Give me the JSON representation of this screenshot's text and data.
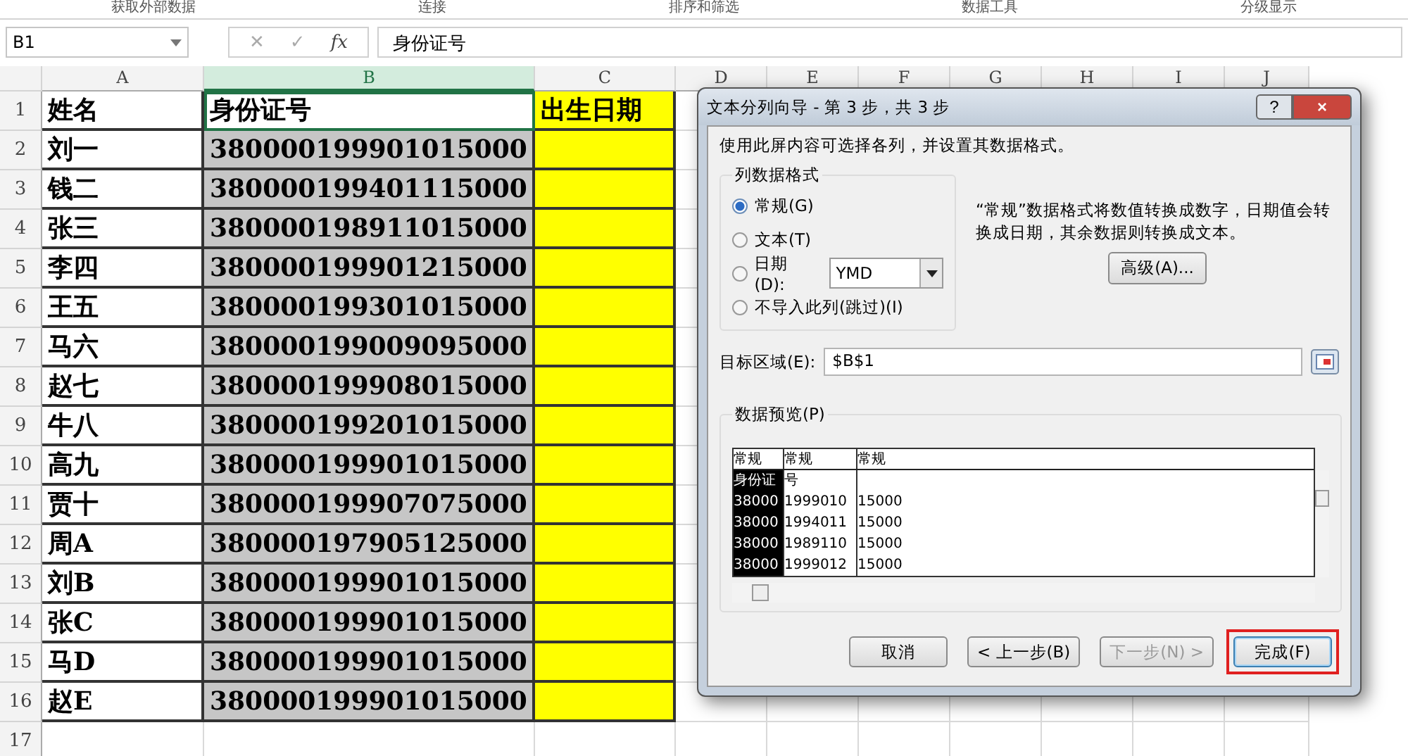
{
  "ribbon_groups": [
    "获取外部数据",
    "连接",
    "排序和筛选",
    "数据工具",
    "分级显示"
  ],
  "name_box": "B1",
  "formula_buttons": [
    {
      "label": "✕",
      "kind": "cancel"
    },
    {
      "label": "✓",
      "kind": "enter"
    },
    {
      "label": "fx",
      "kind": "function"
    }
  ],
  "formula": "身份证号",
  "columns": [
    {
      "label": "A",
      "selected": false,
      "highlighted": false
    },
    {
      "label": "B",
      "selected": true,
      "highlighted": false
    },
    {
      "label": "C",
      "selected": false,
      "highlighted": true
    },
    {
      "label": "D",
      "selected": false,
      "highlighted": false
    },
    {
      "label": "E",
      "selected": false,
      "highlighted": false
    },
    {
      "label": "F",
      "selected": false,
      "highlighted": false
    },
    {
      "label": "G",
      "selected": false,
      "highlighted": false
    },
    {
      "label": "H",
      "selected": false,
      "highlighted": false
    },
    {
      "label": "I",
      "selected": false,
      "highlighted": false
    },
    {
      "label": "J",
      "selected": false,
      "highlighted": false
    }
  ],
  "rows": [
    {
      "number": "1",
      "cells": [
        "姓名",
        "身份证号",
        "出生日期"
      ]
    },
    {
      "number": "2",
      "cells": [
        "刘一",
        "380000199901015000",
        ""
      ]
    },
    {
      "number": "3",
      "cells": [
        "钱二",
        "380000199401115000",
        ""
      ]
    },
    {
      "number": "4",
      "cells": [
        "张三",
        "380000198911015000",
        ""
      ]
    },
    {
      "number": "5",
      "cells": [
        "李四",
        "380000199901215000",
        ""
      ]
    },
    {
      "number": "6",
      "cells": [
        "王五",
        "380000199301015000",
        ""
      ]
    },
    {
      "number": "7",
      "cells": [
        "马六",
        "380000199009095000",
        ""
      ]
    },
    {
      "number": "8",
      "cells": [
        "赵七",
        "380000199908015000",
        ""
      ]
    },
    {
      "number": "9",
      "cells": [
        "牛八",
        "380000199201015000",
        ""
      ]
    },
    {
      "number": "10",
      "cells": [
        "高九",
        "380000199901015000",
        ""
      ]
    },
    {
      "number": "11",
      "cells": [
        "贾十",
        "380000199907075000",
        ""
      ]
    },
    {
      "number": "12",
      "cells": [
        "周A",
        "380000197905125000",
        ""
      ]
    },
    {
      "number": "13",
      "cells": [
        "刘B",
        "380000199901015000",
        ""
      ]
    },
    {
      "number": "14",
      "cells": [
        "张C",
        "380000199901015000",
        ""
      ]
    },
    {
      "number": "15",
      "cells": [
        "马D",
        "380000199901015000",
        ""
      ]
    },
    {
      "number": "16",
      "cells": [
        "赵E",
        "380000199901015000",
        ""
      ]
    },
    {
      "number": "17",
      "cells": []
    }
  ],
  "dialog": {
    "title": "文本分列向导 - 第 3 步，共 3 步",
    "help": "?",
    "close": "×",
    "intro": "使用此屏内容可选择各列，并设置其数据格式。",
    "format_group": {
      "title": "列数据格式",
      "options": [
        {
          "label": "常规(G)",
          "selected": true
        },
        {
          "label": "文本(T)",
          "selected": false
        },
        {
          "label": "日期(D):",
          "selected": false,
          "dropdown": "YMD"
        },
        {
          "label": "不导入此列(跳过)(I)",
          "selected": false
        }
      ]
    },
    "description": "“常规”数据格式将数值转换成数字，日期值会转换成日期，其余数据则转换成文本。",
    "advanced_button": "高级(A)...",
    "destination": {
      "label": "目标区域(E):",
      "value": "$B$1"
    },
    "preview": {
      "title": "数据预览(P)",
      "columns": [
        {
          "label": "常规",
          "selected": true
        },
        {
          "label": "常规",
          "selected": false
        },
        {
          "label": "常规",
          "selected": false
        }
      ],
      "rows": [
        [
          "身份证",
          "号",
          ""
        ],
        [
          "38000",
          "1999010",
          "15000"
        ],
        [
          "38000",
          "1994011",
          "15000"
        ],
        [
          "38000",
          "1989110",
          "15000"
        ],
        [
          "38000",
          "1999012",
          "15000"
        ]
      ]
    },
    "buttons": [
      {
        "label": "取消",
        "disabled": false,
        "highlighted": false
      },
      {
        "label": "< 上一步(B)",
        "disabled": false,
        "highlighted": false
      },
      {
        "label": "下一步(N) >",
        "disabled": true,
        "highlighted": false
      },
      {
        "label": "完成(F)",
        "disabled": false,
        "highlighted": true
      }
    ]
  }
}
